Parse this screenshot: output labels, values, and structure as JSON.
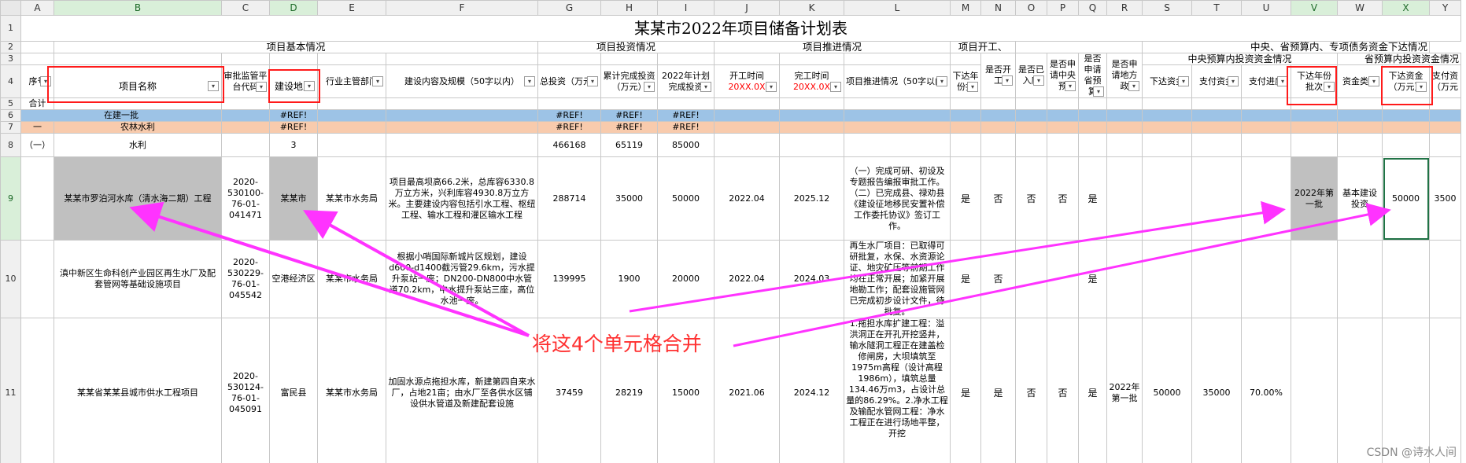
{
  "columns": [
    "A",
    "B",
    "C",
    "D",
    "E",
    "F",
    "G",
    "H",
    "I",
    "J",
    "K",
    "L",
    "M",
    "N",
    "O",
    "P",
    "Q",
    "R",
    "S",
    "T",
    "U",
    "V",
    "W",
    "X",
    "Y"
  ],
  "rows": [
    "1",
    "2",
    "3",
    "4",
    "5",
    "6",
    "7",
    "8",
    "9",
    "10",
    "11"
  ],
  "title": "某某市2022年项目储备计划表",
  "groups": {
    "basic": "项目基本情况",
    "invest": "项目投资情况",
    "progress": "项目推进情况",
    "start": "项目开工、",
    "central_row2": "中央、省预算内、专项债务资金下达情况",
    "central_budget": "中央预算内投资资金情况",
    "prov_budget": "省预算内投资资金情况"
  },
  "headers": {
    "seq": "序号",
    "name": "项目名称",
    "approval": "审批监管平台代码",
    "location": "建设地点",
    "dept": "行业主管部门",
    "content": "建设内容及规模（50字以内）",
    "total": "总投资（万元）",
    "cumulative": "累计完成投资（万元）",
    "plan2022": "2022年计划完成投资",
    "start_time": "开工时间",
    "start_time_val": "20XX.0X",
    "end_time": "完工时间",
    "end_time_val": "20XX.0X",
    "advance": "项目推进情况（50字以内）",
    "started": "是否开工",
    "in_lib": "是否已入库",
    "central_apply": "是否申请中央预",
    "prov_apply": "是否申请省预算",
    "local_apply": "是否申请地方政",
    "year_batch": "下达年份批",
    "issued_funds": "下达资金",
    "paid_funds": "支付资金",
    "pay_progress": "支付进度",
    "year_batch2": "下达年份批次",
    "fund_type": "资金类型",
    "issued_funds2": "下达资金（万元）",
    "paid_funds2": "支付资（万元"
  },
  "rows_data": {
    "total_label": "合计",
    "building": {
      "label": "在建一批",
      "d": "#REF!",
      "g": "#REF!",
      "h": "#REF!",
      "i": "#REF!"
    },
    "agri": {
      "seq": "一",
      "label": "农林水利",
      "d": "#REF!",
      "g": "#REF!",
      "h": "#REF!",
      "i": "#REF!"
    },
    "water": {
      "seq": "（一）",
      "label": "水利",
      "d": "3",
      "g": "466168",
      "h": "65119",
      "i": "85000"
    },
    "p1": {
      "name": "某某市罗泊河水库（清水海二期）工程",
      "code": "2020-530100-76-01-041471",
      "location": "某某市",
      "dept": "某某市水务局",
      "content": "项目最高坝高66.2米，总库容6330.8万立方米，兴利库容4930.8万立方米。主要建设内容包括引水工程、枢纽工程、输水工程和灌区输水工程",
      "total": "288714",
      "cumulative": "35000",
      "plan": "50000",
      "start": "2022.04",
      "end": "2025.12",
      "advance": "（一）完成可研、初设及专题报告编报审批工作。（二）已完成县、禄劝县《建设征地移民安置补偿工作委托协议》签订工作。",
      "m": "是",
      "n": "否",
      "o": "否",
      "p": "否",
      "q": "是",
      "v": "2022年第一批",
      "w": "基本建设投资",
      "x": "50000",
      "y": "3500"
    },
    "p2": {
      "name": "滇中新区生命科创产业园区再生水厂及配套管网等基础设施项目",
      "code": "2020-530229-76-01-045542",
      "location": "空港经济区",
      "dept": "某某市水务局",
      "content": "根据小哨国际新城片区规划，建设d600-d1400截污管29.6km，污水提升泵站一座；DN200-DN800中水管道70.2km，中水提升泵站三座，高位水池一座。",
      "total": "139995",
      "cumulative": "1900",
      "plan": "20000",
      "start": "2022.04",
      "end": "2024.03",
      "advance": "再生水厂项目：已取得可研批复，水保、水资源论证、地灾矿压等前期工作均在正常开展；加紧开展地勘工作；配套设施管网已完成初步设计文件，待批复。",
      "m": "是",
      "n": "否",
      "q": "是"
    },
    "p3": {
      "name": "某某省某某县城市供水工程项目",
      "code": "2020-530124-76-01-045091",
      "location": "富民县",
      "dept": "某某市水务局",
      "content": "加固水源点拖担水库，新建第四自来水厂，占地21亩；由水厂至各供水区铺设供水管道及新建配套设施",
      "total": "37459",
      "cumulative": "28219",
      "plan": "15000",
      "start": "2021.06",
      "end": "2024.12",
      "advance": "1.拖担水库扩建工程：溢洪洞正在开孔开挖竖井，输水隧洞工程正在建盖检修闸房，大坝填筑至1975m高程（设计高程1986m），填筑总量134.46万m3，占设计总量的86.29%。2.净水工程及输配水管网工程：净水工程正在进行场地平整，开挖",
      "m": "是",
      "n": "是",
      "o": "否",
      "p": "否",
      "q": "是",
      "r": "2022年第一批",
      "s": "50000",
      "t": "35000",
      "u": "70.00%"
    }
  },
  "annotation": "将这4个单元格合并",
  "watermark": "CSDN @诗水人间",
  "colors": {
    "accent_red": "#ff1a1a",
    "arrow_magenta": "#ff33ff",
    "blue_row": "#9dc3e6",
    "peach_row": "#f8cbad",
    "gray_cell": "#c0c0c0"
  }
}
